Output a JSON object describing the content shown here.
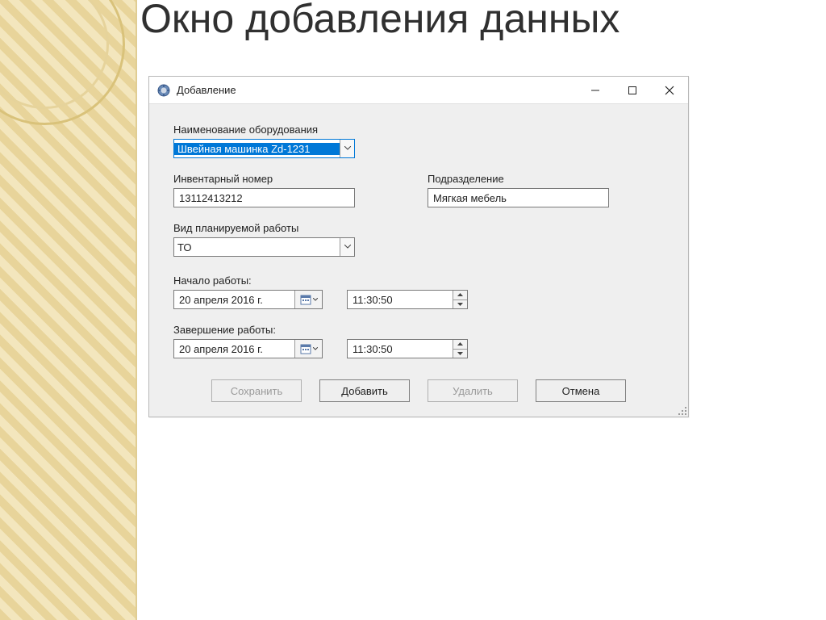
{
  "slide_title": "Окно добавления данных",
  "window": {
    "title": "Добавление",
    "controls": {
      "minimize": "–",
      "maximize": "□",
      "close": "×"
    }
  },
  "fields": {
    "equipment_label": "Наименование оборудования",
    "equipment_value": "Швейная машинка Zd-1231",
    "inventory_label": "Инвентарный номер",
    "inventory_value": "13112413212",
    "department_label": "Подразделение",
    "department_value": "Мягкая мебель",
    "work_type_label": "Вид планируемой работы",
    "work_type_value": "ТО",
    "start_label": "Начало работы:",
    "start_date": "20  апреля  2016 г.",
    "start_time": "11:30:50",
    "end_label": "Завершение работы:",
    "end_date": "20  апреля  2016 г.",
    "end_time": "11:30:50"
  },
  "buttons": {
    "save": "Сохранить",
    "add": "Добавить",
    "delete": "Удалить",
    "cancel": "Отмена"
  }
}
